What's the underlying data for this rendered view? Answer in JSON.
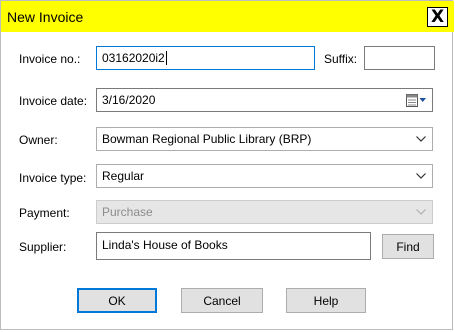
{
  "window": {
    "title": "New Invoice",
    "close_glyph": "X",
    "titlebar_color": "#ffff00"
  },
  "form": {
    "invoice_no": {
      "label": "Invoice no.:",
      "value": "03162020i2"
    },
    "suffix": {
      "label": "Suffix:",
      "value": ""
    },
    "invoice_date": {
      "label": "Invoice date:",
      "value": "3/16/2020"
    },
    "owner": {
      "label": "Owner:",
      "value": "Bowman Regional Public Library (BRP)"
    },
    "invoice_type": {
      "label": "Invoice type:",
      "value": "Regular"
    },
    "payment": {
      "label": "Payment:",
      "value": "Purchase",
      "disabled": true
    },
    "supplier": {
      "label": "Supplier:",
      "value": "Linda's House of Books",
      "find_label": "Find"
    }
  },
  "buttons": {
    "ok": "OK",
    "cancel": "Cancel",
    "help": "Help"
  },
  "colors": {
    "focus_border": "#0078d7",
    "button_face": "#e1e1e1"
  }
}
